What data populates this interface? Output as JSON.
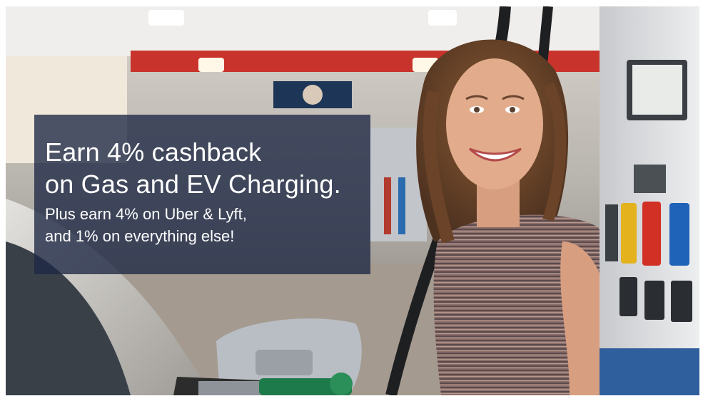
{
  "promo": {
    "headline_line1": "Earn 4% cashback",
    "headline_line2": "on Gas and EV Charging.",
    "subline_line1": "Plus earn 4% on Uber & Lyft,",
    "subline_line2": "and 1% on everything else!"
  },
  "colors": {
    "overlay": "#1e2844",
    "canopy_red": "#c8332b",
    "text": "#ffffff"
  },
  "scene": {
    "subject": "smiling woman at gas pump",
    "icons": [
      "fuel-nozzle-icon",
      "pump-display-icon",
      "gas-station-sign-icon"
    ]
  }
}
